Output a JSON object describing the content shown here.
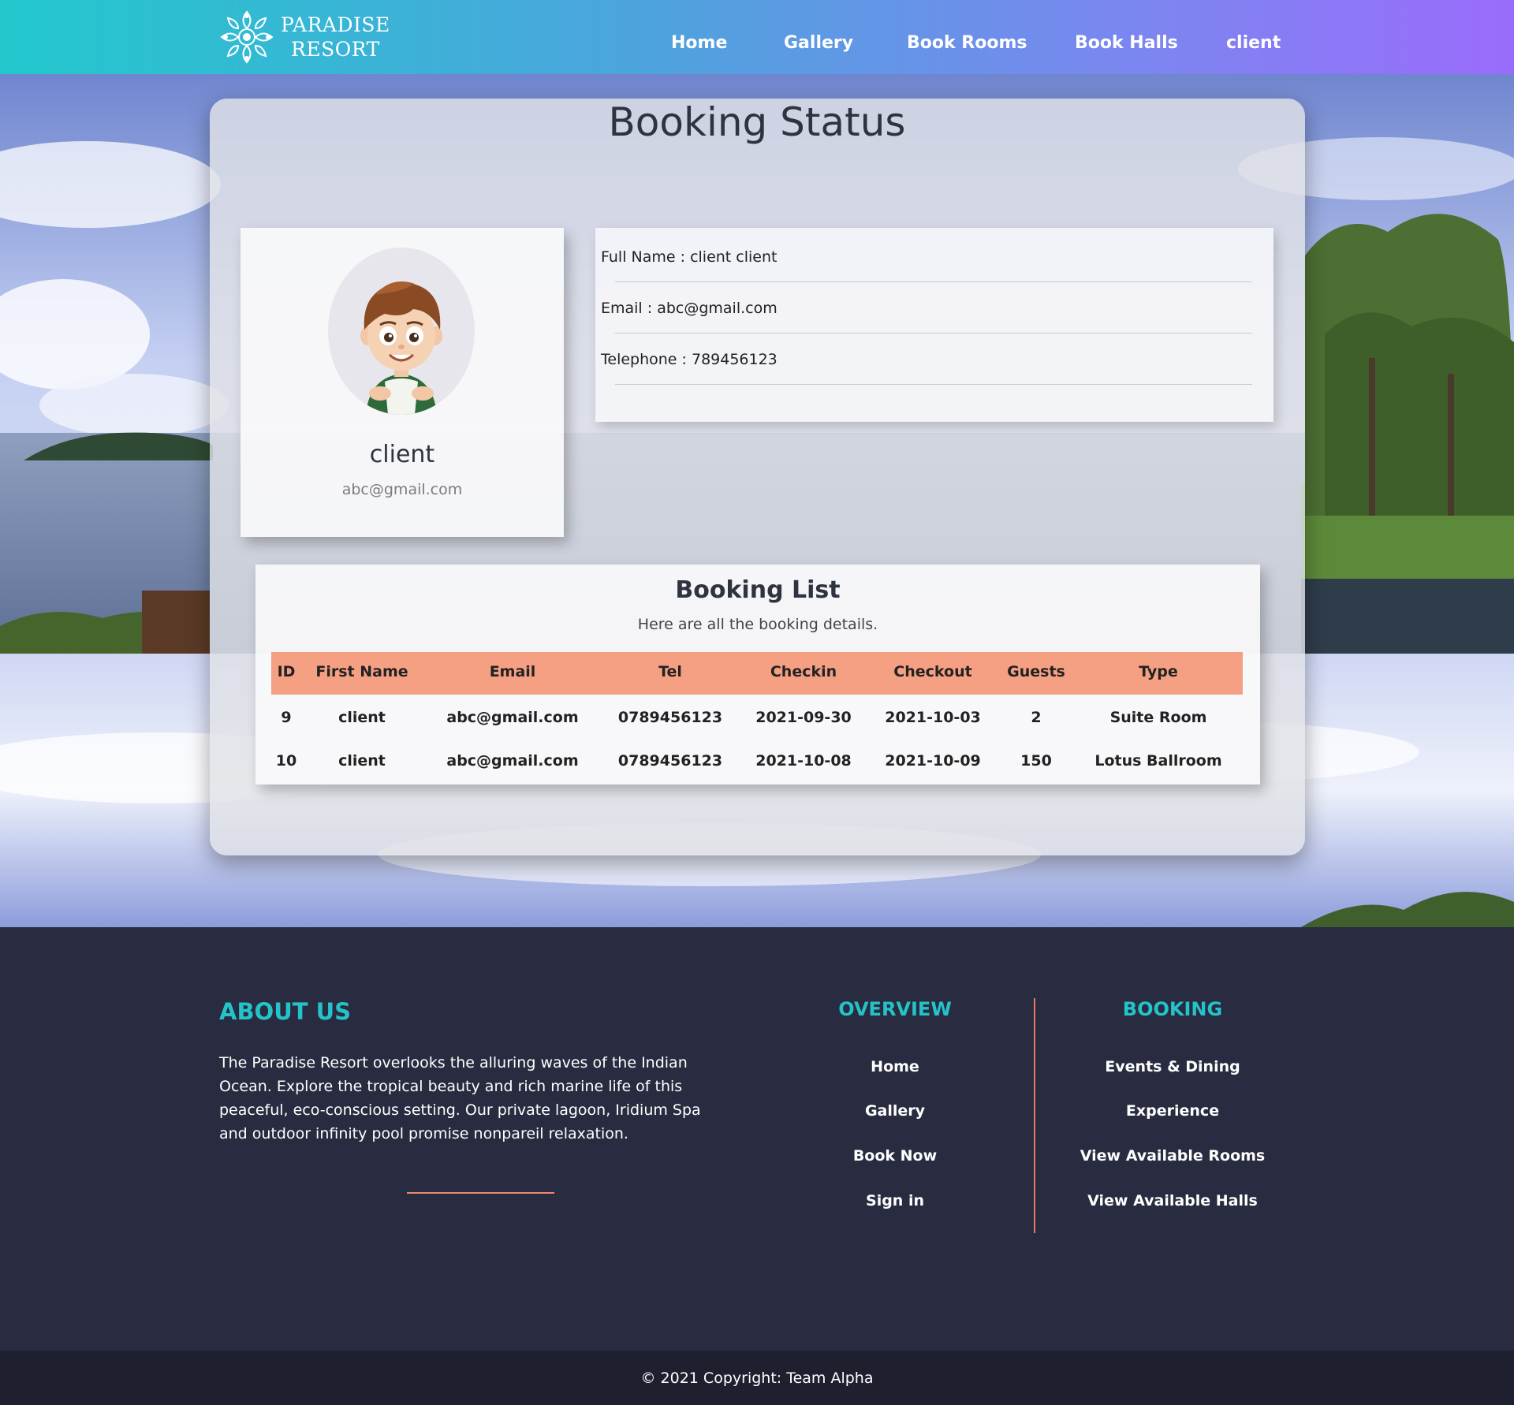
{
  "brand": {
    "line1": "PARADISE",
    "line2": "RESORT"
  },
  "nav": {
    "home": "Home",
    "gallery": "Gallery",
    "book_rooms": "Book Rooms",
    "book_halls": "Book Halls",
    "user": "client"
  },
  "page": {
    "title": "Booking Status"
  },
  "profile": {
    "name": "client",
    "email": "abc@gmail.com"
  },
  "details": {
    "full_name": "Full Name : client client",
    "email": "Email : abc@gmail.com",
    "telephone": "Telephone : 789456123"
  },
  "booking_list": {
    "title": "Booking List",
    "subtitle": "Here are all the booking details.",
    "headers": [
      "ID",
      "First Name",
      "Email",
      "Tel",
      "Checkin",
      "Checkout",
      "Guests",
      "Type"
    ],
    "rows": [
      [
        "9",
        "client",
        "abc@gmail.com",
        "0789456123",
        "2021-09-30",
        "2021-10-03",
        "2",
        "Suite Room"
      ],
      [
        "10",
        "client",
        "abc@gmail.com",
        "0789456123",
        "2021-10-08",
        "2021-10-09",
        "150",
        "Lotus Ballroom"
      ]
    ]
  },
  "footer": {
    "about_title": "ABOUT US",
    "about_text": "The Paradise Resort overlooks the alluring waves of the Indian Ocean. Explore the tropical beauty and rich marine life of this peaceful, eco-conscious setting. Our private lagoon, Iridium Spa and outdoor infinity pool promise nonpareil relaxation.",
    "overview_title": "OVERVIEW",
    "overview_links": [
      "Home",
      "Gallery",
      "Book Now",
      "Sign in"
    ],
    "booking_title": "BOOKING",
    "booking_links": [
      "Events & Dining",
      "Experience",
      "View Available Rooms",
      "View Available Halls"
    ],
    "copyright": "© 2021 Copyright: Team Alpha"
  },
  "colors": {
    "accent_teal": "#24c3c7",
    "table_header": "#f6a083",
    "footer_bg": "#292c40",
    "divider_coral": "#e8785c"
  }
}
